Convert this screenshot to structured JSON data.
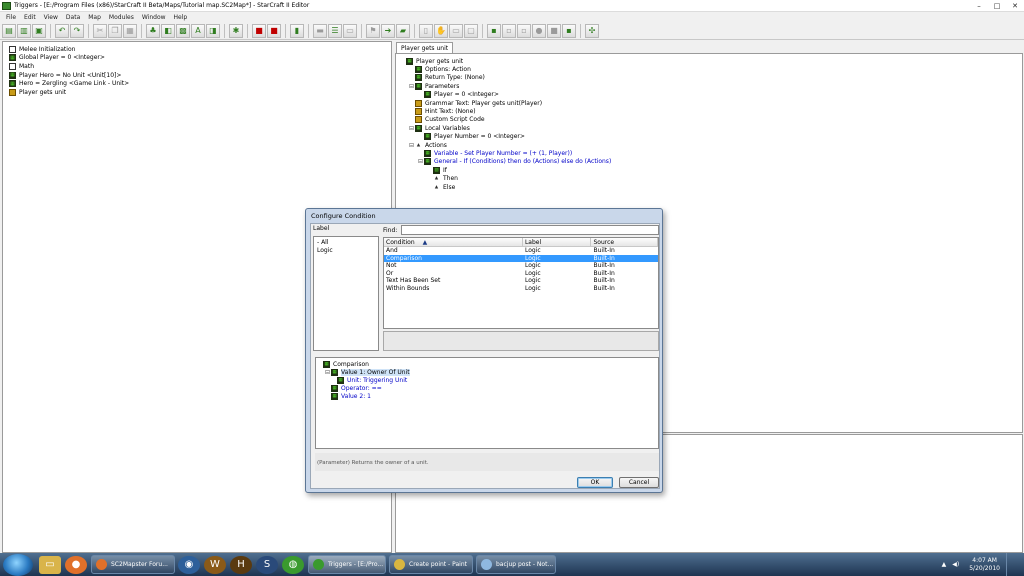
{
  "window": {
    "title": "Triggers - [E:/Program Files (x86)/StarCraft II Beta/Maps/Tutorial map.SC2Map*] - StarCraft II Editor",
    "controls": [
      "–",
      "□",
      "✕"
    ]
  },
  "menu": [
    "File",
    "Edit",
    "View",
    "Data",
    "Map",
    "Modules",
    "Window",
    "Help"
  ],
  "left_tree": [
    {
      "label": "Melee Initialization",
      "icon": "document-icon"
    },
    {
      "label": "Global Player = 0 <Integer>",
      "icon": "variable-icon"
    },
    {
      "label": "Math",
      "icon": "document-icon"
    },
    {
      "label": "Player Hero = No Unit <Unit[10]>",
      "icon": "variable-icon"
    },
    {
      "label": "Hero = Zergling <Game Link - Unit>",
      "icon": "variable-icon"
    },
    {
      "label": "Player gets unit",
      "icon": "trigger-icon"
    }
  ],
  "right": {
    "tab_label": "Player gets unit",
    "tree": [
      {
        "indent": 0,
        "exp": "",
        "icon": "function-icon",
        "label": "Player gets unit",
        "blue": false
      },
      {
        "indent": 1,
        "exp": "",
        "icon": "variable-icon",
        "label": "Options: Action",
        "blue": false
      },
      {
        "indent": 1,
        "exp": "",
        "icon": "variable-icon",
        "label": "Return Type: (None)",
        "blue": false
      },
      {
        "indent": 1,
        "exp": "⊟",
        "icon": "variable-icon",
        "label": "Parameters",
        "blue": false
      },
      {
        "indent": 2,
        "exp": "",
        "icon": "variable-icon",
        "label": "Player = 0 <Integer>",
        "blue": false
      },
      {
        "indent": 1,
        "exp": "",
        "icon": "trigger-icon",
        "label": "Grammar Text: Player gets unit(Player)",
        "blue": false
      },
      {
        "indent": 1,
        "exp": "",
        "icon": "trigger-icon",
        "label": "Hint Text: (None)",
        "blue": false
      },
      {
        "indent": 1,
        "exp": "",
        "icon": "trigger-icon",
        "label": "Custom Script Code",
        "blue": false
      },
      {
        "indent": 1,
        "exp": "⊟",
        "icon": "variable-icon",
        "label": "Local Variables",
        "blue": false
      },
      {
        "indent": 2,
        "exp": "",
        "icon": "variable-icon",
        "label": "Player Number = 0 <Integer>",
        "blue": false
      },
      {
        "indent": 1,
        "exp": "⊟",
        "icon": "folder-icon",
        "label": "Actions",
        "blue": false
      },
      {
        "indent": 2,
        "exp": "",
        "icon": "variable-icon",
        "label": "Variable - Set Player Number = (+ (1, Player))",
        "blue": true
      },
      {
        "indent": 2,
        "exp": "⊟",
        "icon": "variable-icon",
        "label": "General - If (Conditions) then do (Actions) else do (Actions)",
        "blue": true
      },
      {
        "indent": 3,
        "exp": "",
        "icon": "if-icon",
        "label": "If",
        "blue": false
      },
      {
        "indent": 3,
        "exp": "",
        "icon": "folder-icon",
        "label": "Then",
        "blue": false
      },
      {
        "indent": 3,
        "exp": "",
        "icon": "folder-icon",
        "label": "Else",
        "blue": false
      }
    ]
  },
  "dialog": {
    "title": "Configure Condition",
    "label_heading": "Label",
    "label_items": [
      "- All",
      "Logic"
    ],
    "find_label": "Find:",
    "find_value": "",
    "columns": [
      "Condition",
      "Label",
      "Source"
    ],
    "rows": [
      {
        "name": "And",
        "label": "Logic",
        "source": "Built-In",
        "selected": false
      },
      {
        "name": "Comparison",
        "label": "Logic",
        "source": "Built-In",
        "selected": true
      },
      {
        "name": "Not",
        "label": "Logic",
        "source": "Built-In",
        "selected": false
      },
      {
        "name": "Or",
        "label": "Logic",
        "source": "Built-In",
        "selected": false
      },
      {
        "name": "Text Has Been Set",
        "label": "Logic",
        "source": "Built-In",
        "selected": false
      },
      {
        "name": "Within Bounds",
        "label": "Logic",
        "source": "Built-In",
        "selected": false
      }
    ],
    "tree": [
      {
        "indent": 0,
        "exp": "",
        "label": "Comparison",
        "blue": false
      },
      {
        "indent": 0,
        "exp": "⊟",
        "label": "Value 1: Owner Of Unit",
        "blue": false
      },
      {
        "indent": 1,
        "exp": "",
        "label": "Unit: Triggering Unit",
        "blue": true
      },
      {
        "indent": 0,
        "exp": "",
        "label": "Operator: ==",
        "blue": true
      },
      {
        "indent": 0,
        "exp": "",
        "label": "Value 2: 1",
        "blue": true
      }
    ],
    "help_text": "(Parameter) Returns the owner of a unit.",
    "ok_label": "OK",
    "cancel_label": "Cancel"
  },
  "taskbar": {
    "buttons": [
      {
        "label": "SC2Mapster Foru...",
        "color": "#e0702a",
        "active": false
      },
      {
        "label": "Triggers - [E:/Pro...",
        "color": "#3a9a2e",
        "active": true
      },
      {
        "label": "Create point - Paint",
        "color": "#d8b640",
        "active": false
      },
      {
        "label": "bacjup post - Not...",
        "color": "#8fb8e0",
        "active": false
      }
    ],
    "time": "4:07 AM",
    "date": "5/20/2010"
  },
  "colors": {
    "selection": "#3399ff",
    "link_blue": "#0000c8",
    "icon_green": "#52d62a",
    "trigger_gold": "#c89b18"
  }
}
